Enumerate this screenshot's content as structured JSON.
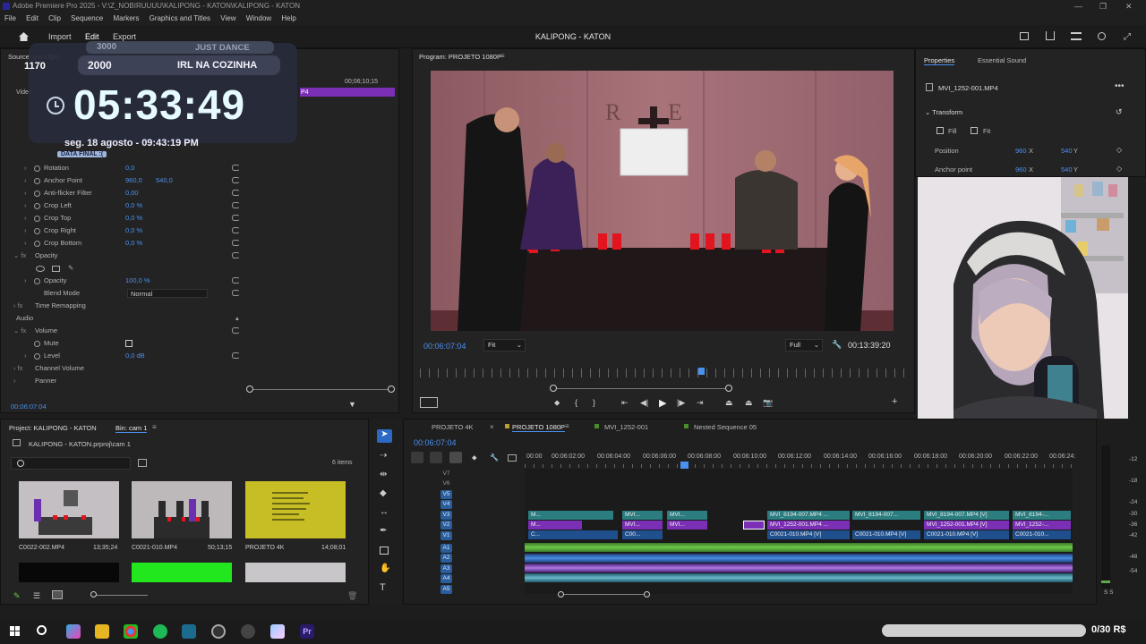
{
  "app": {
    "title": "Adobe Premiere Pro 2025 - V:\\Z_NOBIRUUUU\\KALIPONG - KATON\\KALIPONG - KATON"
  },
  "menu": [
    "File",
    "Edit",
    "Clip",
    "Sequence",
    "Markers",
    "Graphics and Titles",
    "View",
    "Window",
    "Help"
  ],
  "header": {
    "import": "Import",
    "edit": "Edit",
    "export": "Export",
    "project_name": "KALIPONG - KATON"
  },
  "source": {
    "label": "Source: (no clips)",
    "timecode_end": "00;06;10;15",
    "clip_tag": "P4",
    "timecode": "00:06:07:04"
  },
  "overlay": {
    "goal1": "3000",
    "goal1_label": "JUST DANCE",
    "goal2": "2000",
    "goal2_label": "IRL NA COZINHA",
    "side_value": "1170",
    "clock": "05:33:49",
    "date": "seg. 18 agosto - 09:43:19 PM",
    "final_label": "DATA FINAL :("
  },
  "effects": {
    "rows": [
      {
        "label": "Rotation",
        "v1": "0,0"
      },
      {
        "label": "Anchor Point",
        "v1": "960,0",
        "v2": "540,0"
      },
      {
        "label": "Anti-flicker Filter",
        "v1": "0,00"
      },
      {
        "label": "Crop Left",
        "v1": "0,0 %"
      },
      {
        "label": "Crop Top",
        "v1": "0,0 %"
      },
      {
        "label": "Crop Right",
        "v1": "0,0 %"
      },
      {
        "label": "Crop Bottom",
        "v1": "0,0 %"
      }
    ],
    "opacity_section": "Opacity",
    "opacity_label": "Opacity",
    "opacity_value": "100,0 %",
    "blend_label": "Blend Mode",
    "blend_value": "Normal",
    "time_remap": "Time Remapping",
    "audio": "Audio",
    "volume": "Volume",
    "mute": "Mute",
    "level_label": "Level",
    "level_value": "0,0 dB",
    "channel_volume": "Channel Volume",
    "panner": "Panner",
    "video_label": "Video"
  },
  "program": {
    "title": "Program: PROJETO 1080P",
    "timecode": "00:06:07:04",
    "fit": "Fit",
    "quality": "Full",
    "duration": "00:13:39:20"
  },
  "properties": {
    "tab1": "Properties",
    "tab2": "Essential Sound",
    "clip": "MVI_1252-001.MP4",
    "transform": "Transform",
    "fill": "Fill",
    "fit": "Fit",
    "position_label": "Position",
    "pos_x": "960",
    "pos_y": "540",
    "anchor_label": "Anchor point",
    "anc_x": "960",
    "anc_y": "540",
    "x_unit": "X",
    "y_unit": "Y"
  },
  "project": {
    "tab": "Project: KALIPONG - KATON",
    "bin": "Bin: cam 1",
    "path": "KALIPONG - KATON.prproj\\cam 1",
    "items": "6 items",
    "thumbs": [
      {
        "name": "C0022-002.MP4",
        "dur": "13;35;24"
      },
      {
        "name": "C0021-010.MP4",
        "dur": "50;13;15"
      },
      {
        "name": "PROJETO 4K",
        "dur": "14;08;01"
      }
    ]
  },
  "timeline": {
    "tabs": [
      "PROJETO 4K",
      "PROJETO 1080P",
      "MVI_1252-001",
      "Nested Sequence 05"
    ],
    "timecode": "00:06:07:04",
    "ruler": [
      "00:00",
      "00:06:02:00",
      "00:06:04:00",
      "00:06:06:00",
      "00:06:08:00",
      "00:06:10:00",
      "00:06:12:00",
      "00:06:14:00",
      "00:06:16:00",
      "00:06:18:00",
      "00:06:20:00",
      "00:06:22:00",
      "00:06:24:"
    ],
    "tracks_v": [
      "V7",
      "V6",
      "V5",
      "V4",
      "V3",
      "V2",
      "V1"
    ],
    "tracks_a": [
      "A1",
      "A2",
      "A3",
      "A4",
      "A5"
    ],
    "clips_v3": [
      "M...",
      "MVI...",
      "MVI...",
      "MVI_8194-007.MP4 ...",
      "MVI_8194-007...",
      "MVI_8194-007.MP4 [V]",
      "MVI_8194-..."
    ],
    "clips_v2": [
      "M...",
      "MVI...",
      "MVI...",
      "MVI_1252-001.MP4 ...",
      "MVI_1252-001.MP4 [V]",
      "MVI_1252-..."
    ],
    "clips_v1": [
      "C...",
      "C00...",
      "C0021-010.MP4 [V]",
      "C0021-010.MP4 [V]",
      "C0021-010.MP4 [V]",
      "C0021-010..."
    ],
    "meter": [
      "-12",
      "-18",
      "-24",
      "-30",
      "-36",
      "-42",
      "-48",
      "-54"
    ],
    "solo_labels": "S S"
  },
  "taskbar": {
    "price": "0/30 R$"
  },
  "colors": {
    "accent": "#4a90ee",
    "purple": "#7b2fb5",
    "teal": "#2b8a8a"
  }
}
